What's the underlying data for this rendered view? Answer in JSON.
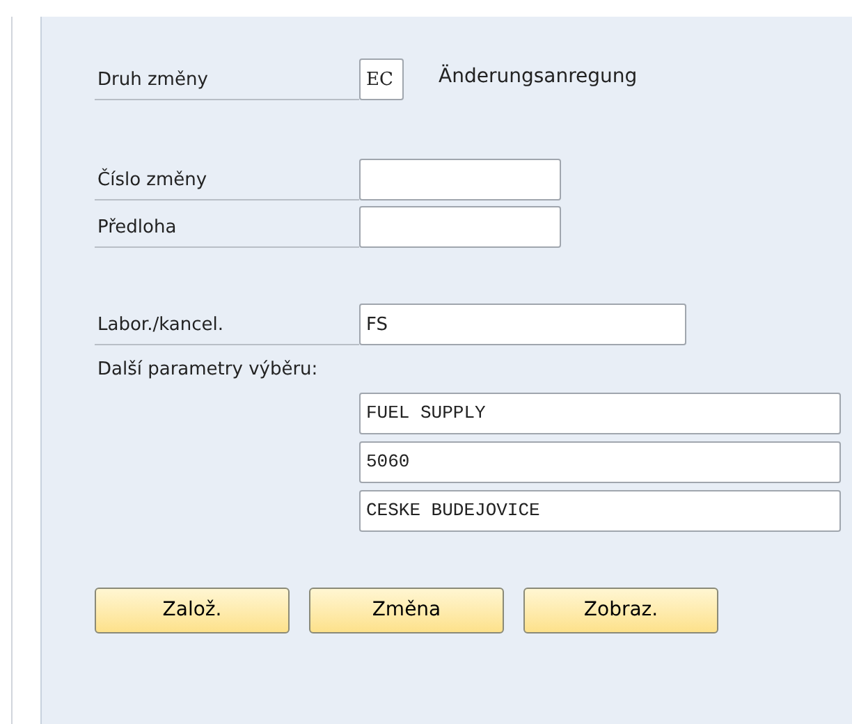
{
  "fields": [
    {
      "kind": "short",
      "label": "Druh změny",
      "value": "EC",
      "description": "Änderungsanregung"
    },
    {
      "kind": "medium",
      "label": "Číslo změny"
    },
    {
      "kind": "medium",
      "label": "Předloha"
    },
    {
      "kind": "long",
      "label": "Labor./kancel.",
      "value": "FS"
    }
  ],
  "more_params": {
    "label": "Další parametry výběru:",
    "values": [
      "FUEL SUPPLY",
      "5060",
      "CESKE BUDEJOVICE"
    ]
  },
  "buttons": [
    "Založ.",
    "Změna",
    "Zobraz."
  ]
}
